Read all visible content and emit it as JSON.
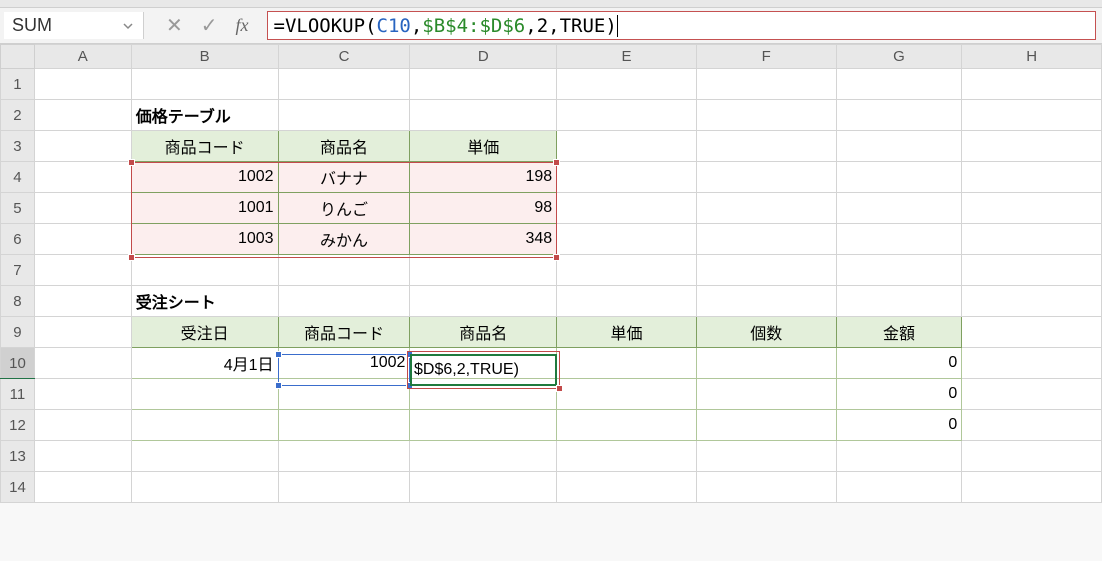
{
  "namebox": {
    "value": "SUM"
  },
  "formula": {
    "parts": {
      "eq": "=",
      "fn": "VLOOKUP",
      "open": "(",
      "arg1": "C10",
      "comma1": ",",
      "arg2": "$B$4:$D$6",
      "comma2": ",",
      "arg3": "2",
      "comma3": ",",
      "arg4": "TRUE",
      "close": ")"
    }
  },
  "columns": [
    "A",
    "B",
    "C",
    "D",
    "E",
    "F",
    "G",
    "H"
  ],
  "row_count": 14,
  "title1": "価格テーブル",
  "table1": {
    "headers": [
      "商品コード",
      "商品名",
      "単価"
    ],
    "rows": [
      {
        "code": "1002",
        "name": "バナナ",
        "price": "198"
      },
      {
        "code": "1001",
        "name": "りんご",
        "price": "98"
      },
      {
        "code": "1003",
        "name": "みかん",
        "price": "348"
      }
    ]
  },
  "title2": "受注シート",
  "table2": {
    "headers": [
      "受注日",
      "商品コード",
      "商品名",
      "単価",
      "個数",
      "金額"
    ],
    "rows": [
      {
        "date": "4月1日",
        "code": "1002",
        "name_editing": "$D$6,2,TRUE)",
        "amount": "0"
      },
      {
        "amount": "0"
      },
      {
        "amount": "0"
      }
    ]
  },
  "active_cell": "D10"
}
